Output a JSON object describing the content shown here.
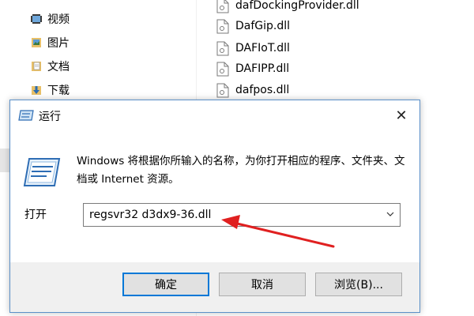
{
  "explorer": {
    "nav_items": [
      {
        "label": "视频",
        "icon": "video-folder-icon"
      },
      {
        "label": "图片",
        "icon": "pictures-folder-icon"
      },
      {
        "label": "文档",
        "icon": "documents-folder-icon"
      },
      {
        "label": "下载",
        "icon": "downloads-folder-icon"
      }
    ],
    "files": [
      {
        "name": "dafDockingProvider.dll"
      },
      {
        "name": "DafGip.dll"
      },
      {
        "name": "DAFIoT.dll"
      },
      {
        "name": "DAFIPP.dll"
      },
      {
        "name": "dafpos.dll"
      }
    ]
  },
  "dialog": {
    "title": "运行",
    "close_glyph": "✕",
    "description": "Windows 将根据你所输入的名称，为你打开相应的程序、文件夹、文档或 Internet 资源。",
    "open_label": "打开",
    "command_value": "regsvr32 d3dx9-36.dll",
    "buttons": {
      "ok": "确定",
      "cancel": "取消",
      "browse": "浏览(B)..."
    }
  },
  "colors": {
    "accent_border": "#5b90c8",
    "default_button_border": "#0078d7",
    "annotation_arrow": "#e02020"
  }
}
